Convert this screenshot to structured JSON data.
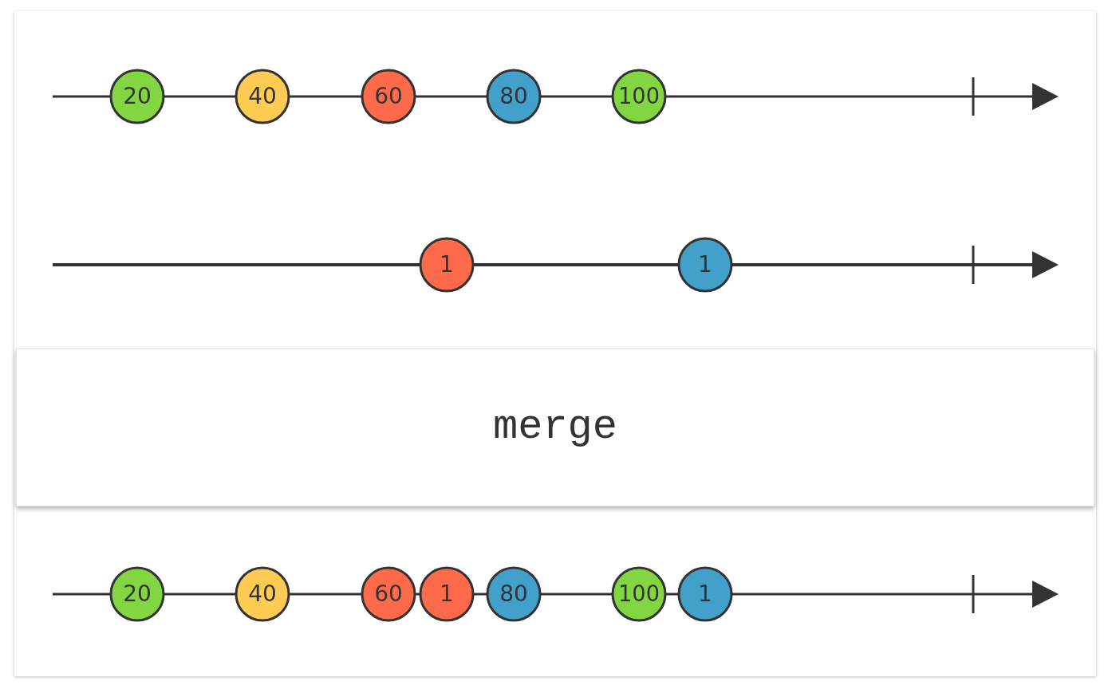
{
  "input_streams": [
    {
      "marbles": [
        {
          "label": "20",
          "color": "#82d642"
        },
        {
          "label": "40",
          "color": "#ffcb52"
        },
        {
          "label": "60",
          "color": "#ff6a4b"
        },
        {
          "label": "80",
          "color": "#43a0ca"
        },
        {
          "label": "100",
          "color": "#82d642"
        }
      ]
    },
    {
      "marbles": [
        {
          "label": "1",
          "color": "#ff6a4b"
        },
        {
          "label": "1",
          "color": "#43a0ca"
        }
      ]
    }
  ],
  "operator": {
    "label": "merge"
  },
  "output_stream": {
    "marbles": [
      {
        "label": "20",
        "color": "#82d642"
      },
      {
        "label": "40",
        "color": "#ffcb52"
      },
      {
        "label": "60",
        "color": "#ff6a4b"
      },
      {
        "label": "1",
        "color": "#ff6a4b"
      },
      {
        "label": "80",
        "color": "#43a0ca"
      },
      {
        "label": "100",
        "color": "#82d642"
      },
      {
        "label": "1",
        "color": "#43a0ca"
      }
    ]
  }
}
